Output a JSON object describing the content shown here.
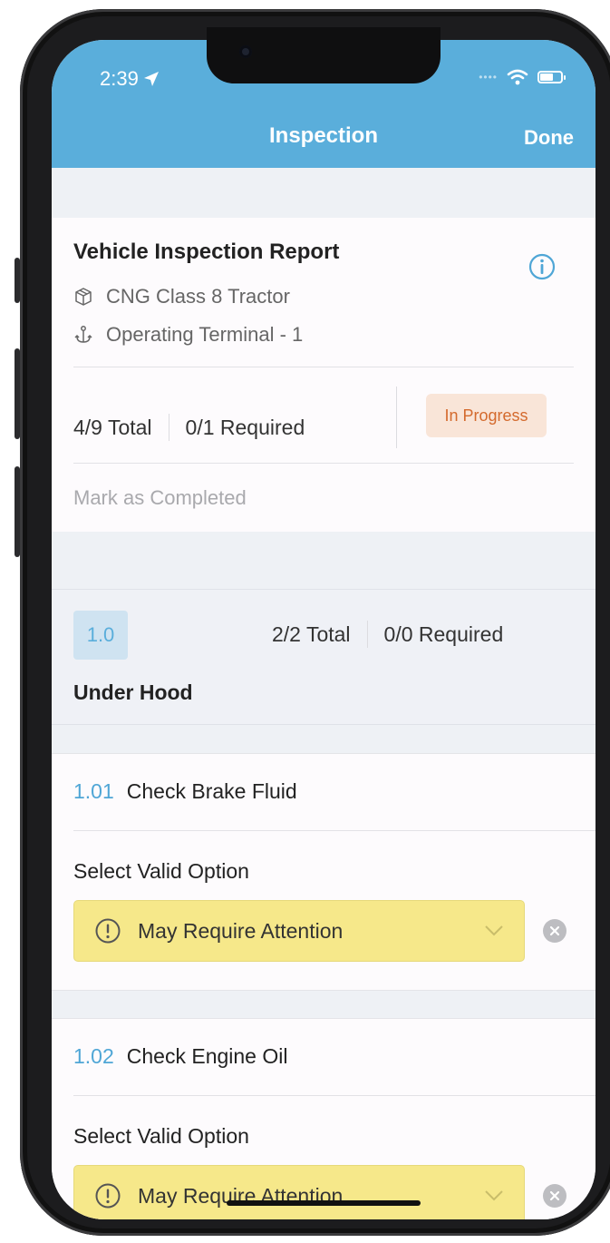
{
  "status_bar": {
    "time": "2:39"
  },
  "nav": {
    "title": "Inspection",
    "done_label": "Done"
  },
  "report": {
    "title": "Vehicle Inspection Report",
    "vehicle": "CNG Class 8 Tractor",
    "terminal": "Operating Terminal - 1",
    "total": "4/9 Total",
    "required": "0/1 Required",
    "status": "In Progress",
    "mark_completed": "Mark as Completed"
  },
  "section": {
    "number": "1.0",
    "total": "2/2 Total",
    "required": "0/0 Required",
    "title": "Under Hood"
  },
  "items": [
    {
      "number": "1.01",
      "title": "Check Brake Fluid",
      "select_label": "Select Valid Option",
      "value": "May Require Attention"
    },
    {
      "number": "1.02",
      "title": "Check Engine Oil",
      "select_label": "Select Valid Option",
      "value": "May Require Attention"
    }
  ],
  "colors": {
    "nav": "#5aaedb",
    "accent": "#4fa6d6",
    "badge_bg": "#f9e5d8",
    "badge_text": "#d46a2d",
    "dropdown": "#f6e88a"
  }
}
